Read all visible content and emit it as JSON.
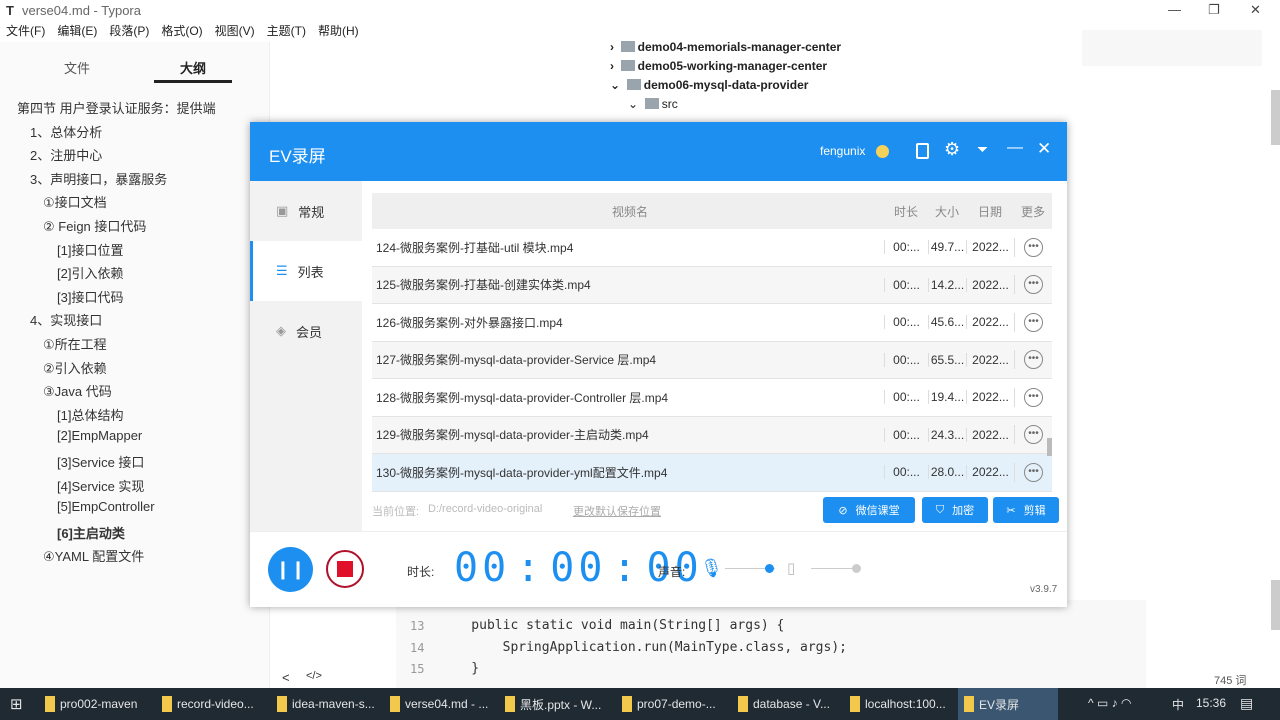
{
  "window": {
    "icon": "T",
    "title": "verse04.md - Typora"
  },
  "menu": [
    "文件(F)",
    "编辑(E)",
    "段落(P)",
    "格式(O)",
    "视图(V)",
    "主题(T)",
    "帮助(H)"
  ],
  "sidebar": {
    "tabs": [
      "文件",
      "大纲"
    ],
    "outline": [
      {
        "text": "第四节 用户登录认证服务：提供端",
        "level": 0
      },
      {
        "text": "1、总体分析",
        "level": 1
      },
      {
        "text": "2、注册中心",
        "level": 1
      },
      {
        "text": "3、声明接口，暴露服务",
        "level": 1
      },
      {
        "text": "①接口文档",
        "level": 2
      },
      {
        "text": "② Feign 接口代码",
        "level": 2
      },
      {
        "text": "[1]接口位置",
        "level": 3
      },
      {
        "text": "[2]引入依赖",
        "level": 3
      },
      {
        "text": "[3]接口代码",
        "level": 3
      },
      {
        "text": "4、实现接口",
        "level": 1
      },
      {
        "text": "①所在工程",
        "level": 2
      },
      {
        "text": "②引入依赖",
        "level": 2
      },
      {
        "text": "③Java 代码",
        "level": 2
      },
      {
        "text": "[1]总体结构",
        "level": 3
      },
      {
        "text": "[2]EmpMapper",
        "level": 3
      },
      {
        "text": "[3]Service 接口",
        "level": 3
      },
      {
        "text": "[4]Service 实现",
        "level": 3
      },
      {
        "text": "[5]EmpController",
        "level": 3
      },
      {
        "text": "[6]主启动类",
        "level": 3
      },
      {
        "text": "④YAML 配置文件",
        "level": 2
      }
    ],
    "footer_left": "<",
    "footer_code": "</>"
  },
  "tree": [
    "demo04-memorials-manager-center",
    "demo05-working-manager-center",
    "demo06-mysql-data-provider",
    "src"
  ],
  "code": {
    "lines": [
      {
        "n": "13",
        "t": "    public static void main(String[] args) {"
      },
      {
        "n": "14",
        "t": "        SpringApplication.run(MainType.class, args);"
      },
      {
        "n": "15",
        "t": "    }"
      }
    ]
  },
  "word_count": "745 词",
  "ev": {
    "title": "EV录屏",
    "user": "fengunix",
    "nav": [
      "常规",
      "列表",
      "会员"
    ],
    "headers": [
      "视频名",
      "时长",
      "大小",
      "日期",
      "更多"
    ],
    "rows": [
      {
        "name": "124-微服务案例-打基础-util 模块.mp4",
        "dur": "00:...",
        "size": "49.7...",
        "date": "2022..."
      },
      {
        "name": "125-微服务案例-打基础-创建实体类.mp4",
        "dur": "00:...",
        "size": "14.2...",
        "date": "2022..."
      },
      {
        "name": "126-微服务案例-对外暴露接口.mp4",
        "dur": "00:...",
        "size": "45.6...",
        "date": "2022..."
      },
      {
        "name": "127-微服务案例-mysql-data-provider-Service 层.mp4",
        "dur": "00:...",
        "size": "65.5...",
        "date": "2022..."
      },
      {
        "name": "128-微服务案例-mysql-data-provider-Controller 层.mp4",
        "dur": "00:...",
        "size": "19.4...",
        "date": "2022..."
      },
      {
        "name": "129-微服务案例-mysql-data-provider-主启动类.mp4",
        "dur": "00:...",
        "size": "24.3...",
        "date": "2022..."
      },
      {
        "name": "130-微服务案例-mysql-data-provider-yml配置文件.mp4",
        "dur": "00:...",
        "size": "28.0...",
        "date": "2022..."
      }
    ],
    "location_label": "当前位置:",
    "location": "D:/record-video-original",
    "change_location": "更改默认保存位置",
    "buttons": [
      "微信课堂",
      "加密",
      "剪辑"
    ],
    "duration_label": "时长:",
    "time": [
      "00",
      "00",
      "00"
    ],
    "sound_label": "声音:",
    "mic_level": 0.9,
    "speaker_level": 0.95,
    "version": "v3.9.7"
  },
  "taskbar": [
    "pro002-maven",
    "record-video...",
    "idea-maven-s...",
    "verse04.md - ...",
    "黑板.pptx - W...",
    "pro07-demo-...",
    "database - V...",
    "localhost:100...",
    "EV录屏"
  ],
  "tray": {
    "ime": "中",
    "clock": "15:36"
  }
}
